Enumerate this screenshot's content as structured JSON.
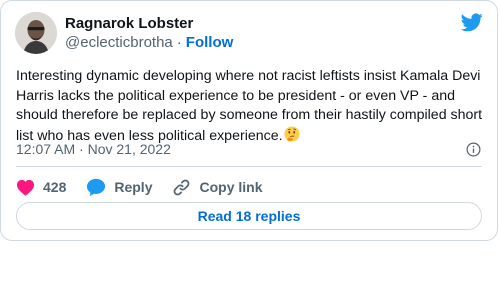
{
  "author": {
    "display_name": "Ragnarok Lobster",
    "handle": "@eclecticbrotha",
    "separator": "·",
    "follow_label": "Follow"
  },
  "tweet": {
    "text": "Interesting dynamic developing where not racist leftists insist Kamala Devi Harris lacks the political experience to be president - or even VP - and should therefore be replaced by someone from their hastily compiled short list who has even less political experience.",
    "trailing_emoji": "thinking-face-icon",
    "timestamp": "12:07 AM · Nov 21, 2022"
  },
  "actions": {
    "like_count": "428",
    "reply_label": "Reply",
    "copy_link_label": "Copy link"
  },
  "replies_button_label": "Read 18 replies",
  "colors": {
    "twitter_blue": "#1d9bf0",
    "link_blue": "#006fd6",
    "like_pink": "#f91880",
    "secondary_text": "#536471",
    "border": "#cfd9de"
  }
}
